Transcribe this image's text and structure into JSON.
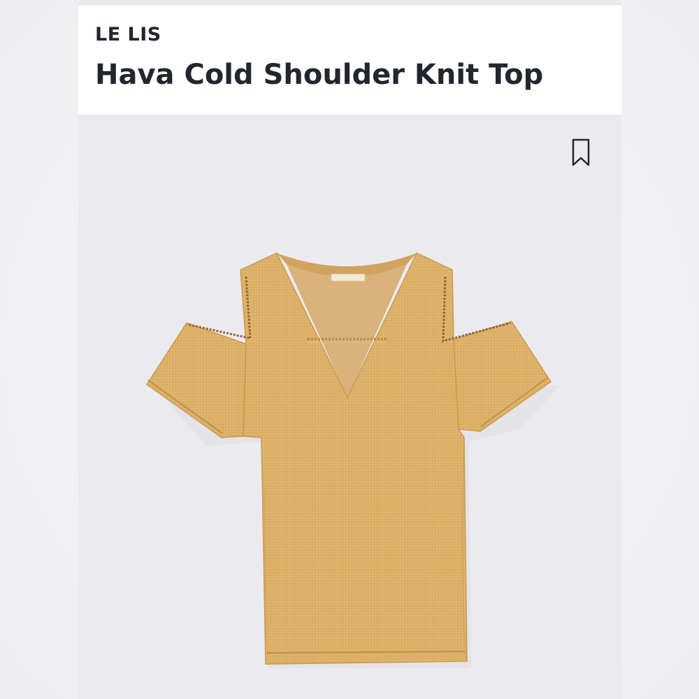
{
  "product": {
    "brand": "LE LIS",
    "title": "Hava Cold Shoulder Knit Top"
  },
  "actions": {
    "bookmark_icon": "bookmark-icon"
  },
  "colors": {
    "garment": "#ddb066",
    "garment_shadow": "#c99a50",
    "background": "#ebebef",
    "text": "#22262e"
  }
}
